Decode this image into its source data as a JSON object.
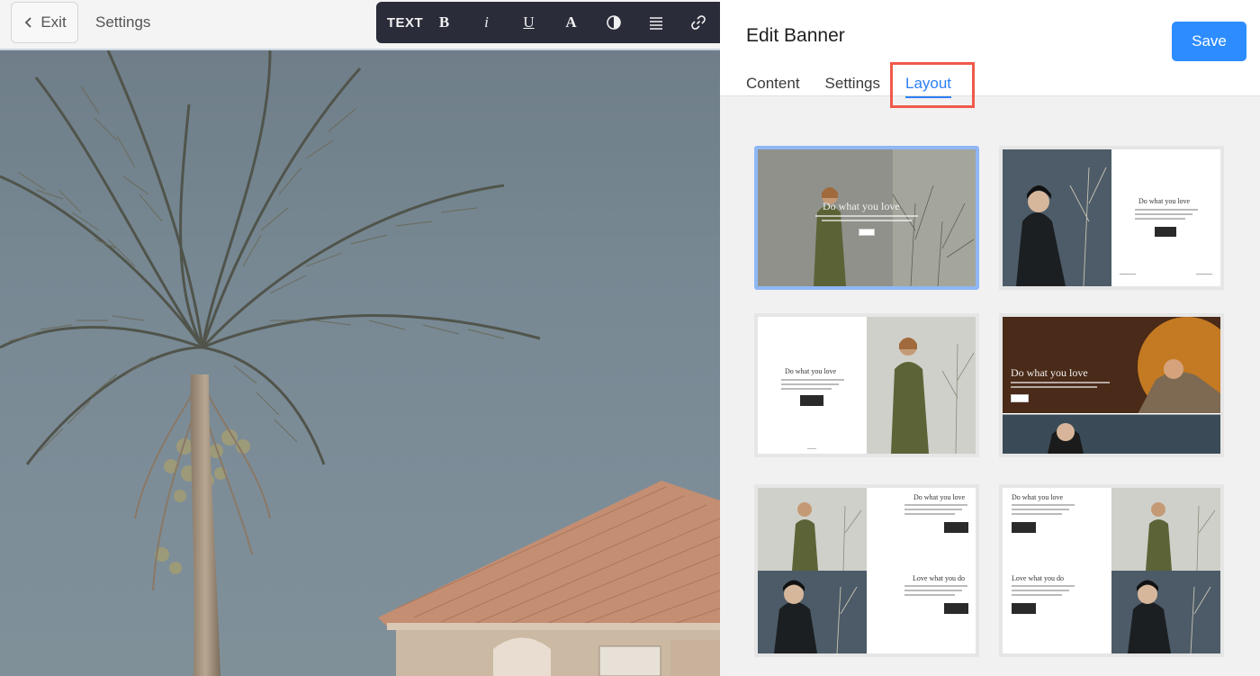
{
  "editor_bar": {
    "exit_label": "Exit",
    "title": "Settings"
  },
  "format_toolbar": {
    "text_label": "TEXT",
    "bold_glyph": "B",
    "italic_glyph": "i",
    "underline_glyph": "U",
    "font_glyph": "A",
    "icons": [
      "bold-icon",
      "italic-icon",
      "underline-icon",
      "font-icon",
      "contrast-icon",
      "align-icon",
      "link-icon"
    ]
  },
  "panel": {
    "title": "Edit Banner",
    "save_label": "Save",
    "tabs": [
      {
        "label": "Content",
        "active": false
      },
      {
        "label": "Settings",
        "active": false
      },
      {
        "label": "Layout",
        "active": true
      }
    ],
    "accent_color": "#2d8cff",
    "highlight_color": "#f05a4a"
  },
  "layouts": [
    {
      "heading": "Do what you love",
      "selected": true
    },
    {
      "heading": "Do what you love",
      "selected": false
    },
    {
      "heading": "Do what you love",
      "selected": false
    },
    {
      "heading": "Do what you love",
      "selected": false
    },
    {
      "heading": "Do what you love",
      "heading2": "Love what you do",
      "selected": false
    },
    {
      "heading": "Do what you love",
      "heading2": "Love what you do",
      "selected": false
    }
  ]
}
